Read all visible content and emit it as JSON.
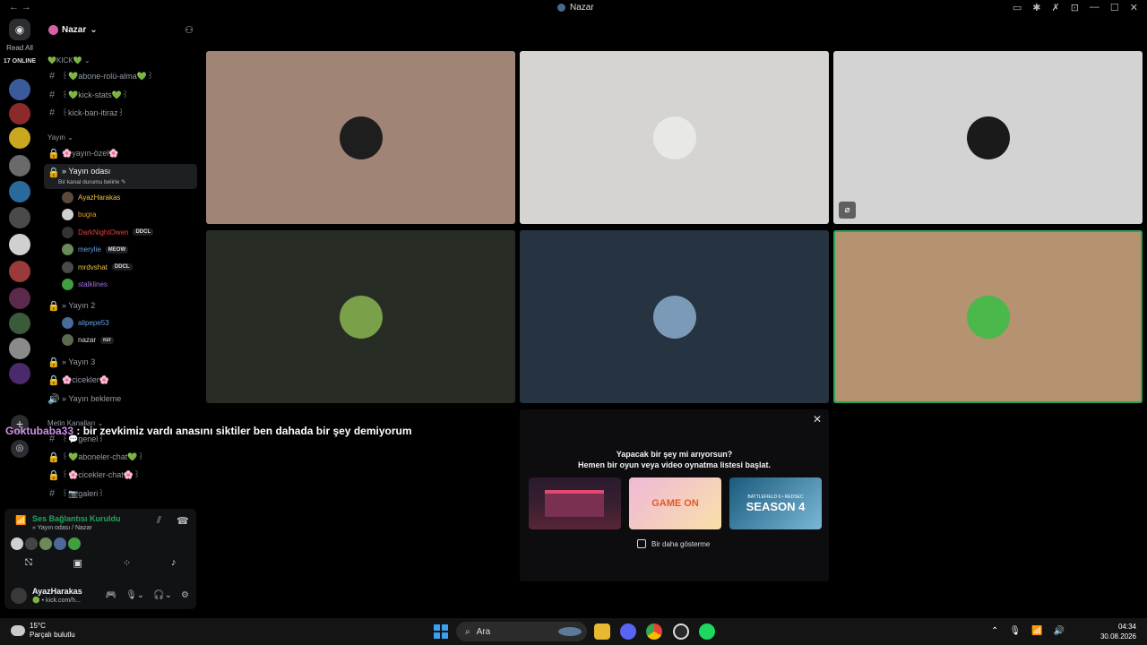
{
  "titlebar": {
    "nav": "←  →",
    "title": "Nazar",
    "icons": [
      "inbox-icon",
      "bug-icon",
      "tools-icon",
      "help-icon",
      "minimize-icon",
      "maximize-icon",
      "close-icon"
    ]
  },
  "rail": {
    "read_all": "Read All",
    "online": "17 ONLINE",
    "servers": [
      {
        "color": "#3a5a9a"
      },
      {
        "color": "#8a2a2a"
      },
      {
        "color": "#c9a820"
      },
      {
        "color": "#6a6a6a"
      },
      {
        "color": "#2a6a9a"
      },
      {
        "color": "#4a4a4a"
      },
      {
        "color": "#d0d0d0"
      },
      {
        "color": "#9a3a3a"
      },
      {
        "color": "#5a2a4a"
      },
      {
        "color": "#3a5a3a"
      },
      {
        "color": "#8a8a8a"
      },
      {
        "color": "#4a2a6a"
      }
    ]
  },
  "server": {
    "name": "Nazar",
    "invite_icon": "add-member-icon"
  },
  "categories": {
    "kick": "💚KICK💚",
    "yayin": "Yayın",
    "metin": "Metin Kanalları"
  },
  "channels": {
    "abone": "꒰💚abone-rolü-alma💚꒱",
    "kickstats": "꒰💚kick-stats💚꒱",
    "kickban": "꒰kick-ban-itiraz꒱",
    "yayinozel": "🌸yayın-özel🌸",
    "yayinodasi": "» Yayın odası",
    "yayinodasi_sub": "Bir kanal durumu belirle ✎",
    "yayin2": "» Yayın 2",
    "yayin3": "» Yayın 3",
    "cicekler": "🌸cicekler🌸",
    "bekleme": "» Yayın bekleme",
    "genel": "꒰💬genel꒱",
    "aboneler": "꒰💚aboneler-chat💚꒱",
    "ciceklerchat": "꒰🌸cicekler-chat🌸꒱",
    "galeri": "꒰📷galeri꒱"
  },
  "voice_users": [
    {
      "name": "AyazHarakas",
      "color": "#f0c040",
      "avatar": "#5a4a3a",
      "tag": ""
    },
    {
      "name": "bugra",
      "color": "#e0a020",
      "avatar": "#d0d0d0",
      "tag": ""
    },
    {
      "name": "DarkNightOwen",
      "color": "#e04040",
      "avatar": "#333333",
      "tag": "DDCL"
    },
    {
      "name": "merylie",
      "color": "#60a0e0",
      "avatar": "#6a8a5a",
      "tag": "MEOW"
    },
    {
      "name": "mrdvshat",
      "color": "#f0c040",
      "avatar": "#4a4a4a",
      "tag": "DDCL"
    },
    {
      "name": "stalklines",
      "color": "#a070e0",
      "avatar": "#40a040",
      "tag": ""
    }
  ],
  "voice_users2": [
    {
      "name": "alipepe53",
      "color": "#60a0e0",
      "avatar": "#4a6a9a",
      "tag": ""
    },
    {
      "name": "nazar",
      "color": "#dbdee1",
      "avatar": "#5a6a4a",
      "tag": "nzr"
    }
  ],
  "overlay": {
    "user": "Goktubaba33",
    "message": " : bir zevkimiz vardı anasını siktiler ben dahada bir şey demiyorum"
  },
  "voice_panel": {
    "status": "Ses Bağlantısı Kuruldu",
    "sub": "» Yayın odası / Nazar",
    "user_name": "AyazHarakas",
    "user_status": "🟢 • kick.com/h..."
  },
  "tiles": [
    {
      "bg": "#a08476",
      "avatar": "#1e1e1e",
      "muted": false
    },
    {
      "bg": "#d6d4d0",
      "avatar": "#e8e8e4",
      "muted": false
    },
    {
      "bg": "#d3d3d3",
      "avatar": "#1a1a1a",
      "muted": true
    },
    {
      "bg": "#272c25",
      "avatar": "#7aa04a",
      "muted": false
    },
    {
      "bg": "#263341",
      "avatar": "#7a9ab8",
      "muted": false
    },
    {
      "bg": "#b59370",
      "avatar": "#4ab84a",
      "muted": false
    }
  ],
  "promo": {
    "question": "Yapacak bir şey mi arıyorsun?",
    "cta": "Hemen bir oyun veya video oynatma listesi başlat.",
    "card2": "GAME ON",
    "card3_small": "BATTLEFIELD 6 • REDSEC",
    "card3": "SEASON 4",
    "dont_show": "Bir daha gösterme"
  },
  "taskbar": {
    "temp": "15°C",
    "weather": "Parçalı bulutlu",
    "search": "Ara",
    "time": "04:34",
    "date": "30.08.2026"
  }
}
